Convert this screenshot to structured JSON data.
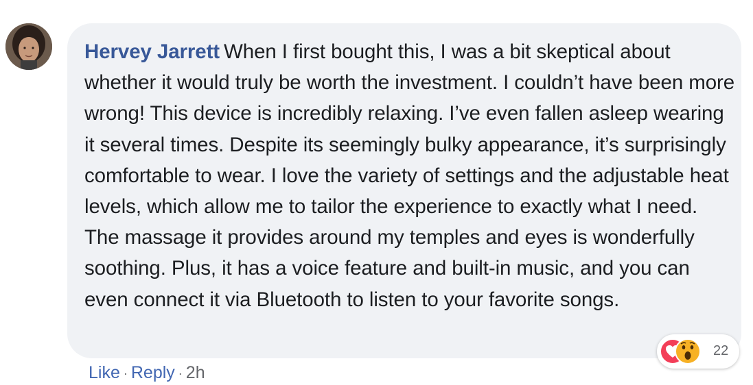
{
  "comment": {
    "author": "Hervey Jarrett",
    "text": "When I first bought this, I was a bit skeptical about whether it would truly be worth the investment. I couldn’t have been more wrong! This device is incredibly relaxing. I’ve even fallen asleep wearing it several times. Despite its seemingly bulky appearance, it’s surprisingly comfortable to wear. I love the variety of settings and the adjustable heat levels, which allow me to tailor the experience to exactly what I need. The massage it provides around my temples and eyes is wonderfully soothing. Plus, it has a voice feature and built-in music, and you can even connect it via Bluetooth to listen to your favorite songs."
  },
  "reactions": {
    "icons": [
      "love-icon",
      "wow-icon"
    ],
    "count": "22"
  },
  "actions": {
    "like": "Like",
    "reply": "Reply",
    "separator": "·",
    "time": "2h"
  },
  "colors": {
    "bubble_bg": "#f0f2f5",
    "author": "#385898",
    "link": "#4267b2",
    "meta": "#65676b"
  }
}
